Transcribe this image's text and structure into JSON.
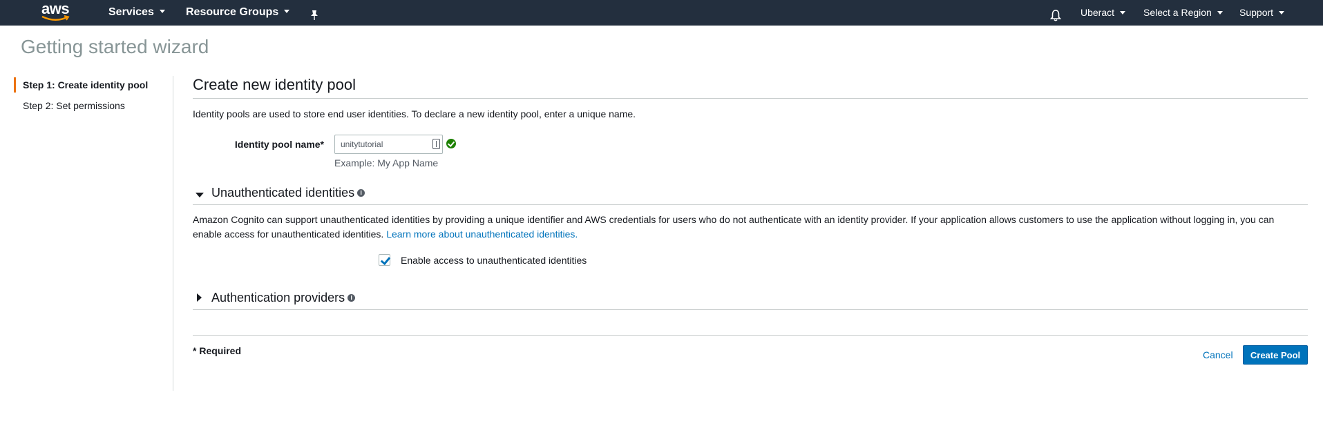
{
  "nav": {
    "logo_text": "aws",
    "services": "Services",
    "resource_groups": "Resource Groups",
    "pin_icon": "pin-icon",
    "bell_icon": "bell-icon",
    "account": "Uberact",
    "region": "Select a Region",
    "support": "Support"
  },
  "page": {
    "title": "Getting started wizard"
  },
  "steps": [
    {
      "label": "Step 1: Create identity pool",
      "active": true
    },
    {
      "label": "Step 2: Set permissions",
      "active": false
    }
  ],
  "main": {
    "heading": "Create new identity pool",
    "description": "Identity pools are used to store end user identities. To declare a new identity pool, enter a unique name.",
    "pool_name_label": "Identity pool name*",
    "pool_name_value": "unitytutorial",
    "example": "Example: My App Name",
    "unauth": {
      "title": "Unauthenticated identities",
      "text_line1": "Amazon Cognito can support unauthenticated identities by providing a unique identifier and AWS credentials for users who do not authenticate with an identity provider. If your application allows customers to use the application without logging in, you can",
      "text_line2": "enable access for unauthenticated identities.",
      "link": "Learn more about unauthenticated identities.",
      "checkbox_label": "Enable access to unauthenticated identities",
      "checked": true
    },
    "auth_providers": {
      "title": "Authentication providers"
    },
    "required_note": "* Required",
    "cancel": "Cancel",
    "create": "Create Pool"
  },
  "colors": {
    "nav_bg": "#232f3e",
    "accent_orange": "#ec7211",
    "link_blue": "#0073bb",
    "success_green": "#1d8102"
  }
}
